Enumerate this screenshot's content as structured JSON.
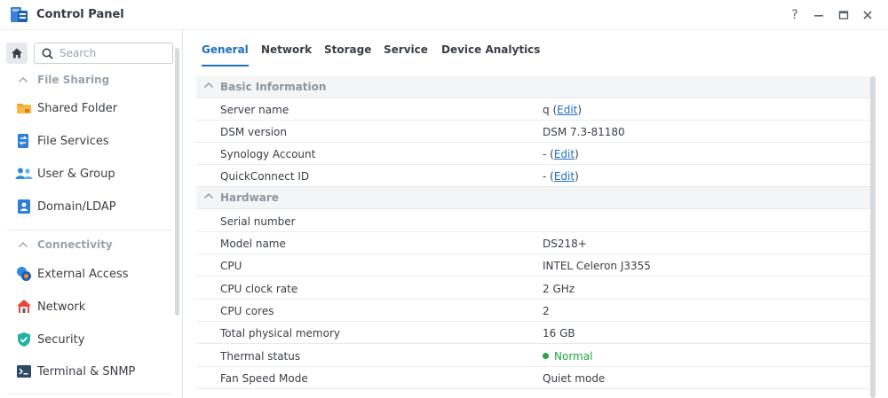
{
  "window": {
    "title": "Control Panel",
    "help_label": "?",
    "minimize_label": "—",
    "maximize_label": "▢",
    "close_label": "✕"
  },
  "sidebar": {
    "search_placeholder": "Search",
    "groups": [
      {
        "title": "File Sharing",
        "items": [
          {
            "label": "Shared Folder",
            "icon": "folder-icon"
          },
          {
            "label": "File Services",
            "icon": "file-services-icon"
          },
          {
            "label": "User & Group",
            "icon": "user-group-icon"
          },
          {
            "label": "Domain/LDAP",
            "icon": "domain-ldap-icon"
          }
        ]
      },
      {
        "title": "Connectivity",
        "items": [
          {
            "label": "External Access",
            "icon": "external-access-icon"
          },
          {
            "label": "Network",
            "icon": "network-house-icon"
          },
          {
            "label": "Security",
            "icon": "shield-check-icon"
          },
          {
            "label": "Terminal & SNMP",
            "icon": "terminal-icon"
          }
        ]
      }
    ]
  },
  "tabs": [
    {
      "label": "General",
      "active": true
    },
    {
      "label": "Network",
      "active": false
    },
    {
      "label": "Storage",
      "active": false
    },
    {
      "label": "Service",
      "active": false
    },
    {
      "label": "Device Analytics",
      "active": false
    }
  ],
  "sections": [
    {
      "title": "Basic Information",
      "rows": [
        {
          "label": "Server name",
          "value": "q",
          "link": "Edit"
        },
        {
          "label": "DSM version",
          "value": "DSM 7.3-81180"
        },
        {
          "label": "Synology Account",
          "value": "-",
          "link": "Edit"
        },
        {
          "label": "QuickConnect ID",
          "value": "-",
          "link": "Edit"
        }
      ]
    },
    {
      "title": "Hardware",
      "rows": [
        {
          "label": "Serial number",
          "value": ""
        },
        {
          "label": "Model name",
          "value": "DS218+"
        },
        {
          "label": "CPU",
          "value": "INTEL Celeron J3355"
        },
        {
          "label": "CPU clock rate",
          "value": "2 GHz"
        },
        {
          "label": "CPU cores",
          "value": "2"
        },
        {
          "label": "Total physical memory",
          "value": "16 GB"
        },
        {
          "label": "Thermal status",
          "value": "Normal",
          "status": "ok"
        },
        {
          "label": "Fan Speed Mode",
          "value": "Quiet mode"
        }
      ]
    }
  ],
  "colors": {
    "accent": "#1f6fbf",
    "status_ok": "#25a63f"
  }
}
